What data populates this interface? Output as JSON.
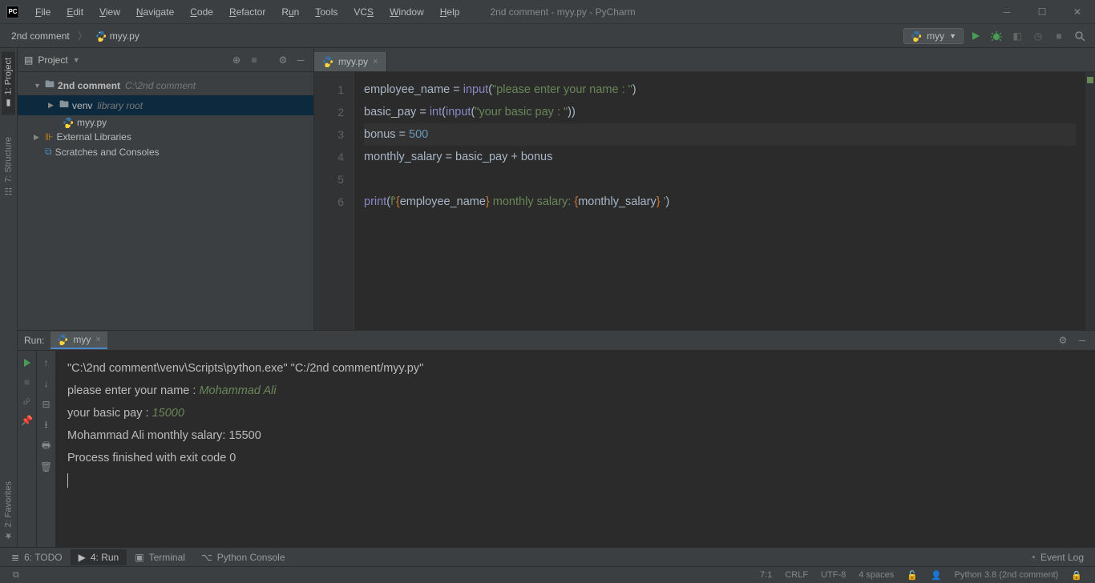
{
  "window": {
    "title": "2nd comment - myy.py - PyCharm"
  },
  "menu": [
    "File",
    "Edit",
    "View",
    "Navigate",
    "Code",
    "Refactor",
    "Run",
    "Tools",
    "VCS",
    "Window",
    "Help"
  ],
  "breadcrumb": {
    "project": "2nd comment",
    "file": "myy.py"
  },
  "run_config": {
    "name": "myy"
  },
  "project_pane": {
    "title": "Project",
    "tree": {
      "root": {
        "name": "2nd comment",
        "path": "C:\\2nd comment"
      },
      "venv": {
        "name": "venv",
        "hint": "library root"
      },
      "file": "myy.py",
      "ext_libs": "External Libraries",
      "scratches": "Scratches and Consoles"
    }
  },
  "side_tabs": {
    "project": "1: Project",
    "structure": "7: Structure",
    "favorites": "2: Favorites"
  },
  "editor": {
    "tab": "myy.py",
    "lines": [
      "1",
      "2",
      "3",
      "4",
      "5",
      "6"
    ],
    "code": {
      "l1_a": "employee_name ",
      "l1_b": "= ",
      "l1_c": "input",
      "l1_d": "(",
      "l1_e": "\"please enter your name : \"",
      "l1_f": ")",
      "l2_a": "basic_pay ",
      "l2_b": "= ",
      "l2_c": "int",
      "l2_d": "(",
      "l2_e": "input",
      "l2_f": "(",
      "l2_g": "\"your basic pay : \"",
      "l2_h": "))",
      "l3_a": "bonus ",
      "l3_b": "= ",
      "l3_c": "500",
      "l4_a": "monthly_salary ",
      "l4_b": "= basic_pay + bonus",
      "l6_a": "print",
      "l6_b": "(",
      "l6_c": "f'",
      "l6_d": "{",
      "l6_e": "employee_name",
      "l6_f": "}",
      "l6_g": " monthly salary: ",
      "l6_h": "{",
      "l6_i": "monthly_salary",
      "l6_j": "}",
      "l6_k": " '",
      "l6_l": ")"
    }
  },
  "run_panel": {
    "label": "Run:",
    "tab": "myy",
    "lines": {
      "cmd": "\"C:\\2nd comment\\venv\\Scripts\\python.exe\" \"C:/2nd comment/myy.py\"",
      "p1": "please enter your name : ",
      "p1v": "Mohammad Ali",
      "p2": "your basic pay : ",
      "p2v": "15000",
      "out": "Mohammad Ali monthly salary: 15500",
      "exit": "Process finished with exit code 0"
    }
  },
  "bottom_tabs": {
    "todo": "6: TODO",
    "run": "4: Run",
    "terminal": "Terminal",
    "pycon": "Python Console",
    "eventlog": "Event Log"
  },
  "statusbar": {
    "pos": "7:1",
    "crlf": "CRLF",
    "enc": "UTF-8",
    "indent": "4 spaces",
    "interp": "Python 3.8 (2nd comment)"
  }
}
